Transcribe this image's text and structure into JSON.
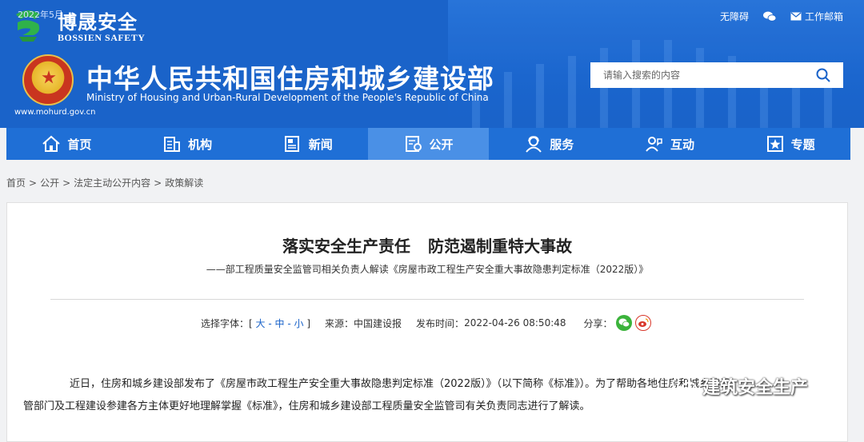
{
  "watermark": {
    "date": "2022年5月",
    "brand": "博晟安全",
    "brand_en": "BOSSIEN SAFETY",
    "bottom": "建筑安全生产"
  },
  "top_links": {
    "accessibility": "无障碍",
    "mail": "工作邮箱"
  },
  "site": {
    "url": "www.mohurd.gov.cn",
    "title_cn": "中华人民共和国住房和城乡建设部",
    "title_en": "Ministry of Housing and Urban-Rural Development of the People's Republic of China"
  },
  "search": {
    "placeholder": "请输入搜索的内容"
  },
  "nav": [
    {
      "label": "首页",
      "icon": "home-icon"
    },
    {
      "label": "机构",
      "icon": "building-icon"
    },
    {
      "label": "新闻",
      "icon": "news-icon"
    },
    {
      "label": "公开",
      "icon": "public-icon",
      "active": true
    },
    {
      "label": "服务",
      "icon": "service-icon"
    },
    {
      "label": "互动",
      "icon": "interaction-icon"
    },
    {
      "label": "专题",
      "icon": "topic-icon"
    }
  ],
  "breadcrumb": [
    "首页",
    "公开",
    "法定主动公开内容",
    "政策解读"
  ],
  "article": {
    "title_a": "落实安全生产责任",
    "title_b": "防范遏制重特大事故",
    "subtitle": "——部工程质量安全监管司相关负责人解读《房屋市政工程生产安全重大事故隐患判定标准（2022版）》",
    "font_label": "选择字体：[",
    "font_big": "大",
    "font_mid": "中",
    "font_small": "小",
    "font_close": "]",
    "source_label": "来源：",
    "source": "中国建设报",
    "time_label": "发布时间：",
    "time": "2022-04-26 08:50:48",
    "share_label": "分享：",
    "para1": "近日，住房和城乡建设部发布了《房屋市政工程生产安全重大事故隐患判定标准（2022版）》（以下简称《标准》）。为了帮助各地住房和城乡建设",
    "para2": "管部门及工程建设参建各方主体更好地理解掌握《标准》，住房和城乡建设部工程质量安全监管司有关负责同志进行了解读。"
  },
  "colors": {
    "header": "#1a63c9",
    "nav": "#1f6fd6",
    "nav_active": "#4a90e6"
  }
}
